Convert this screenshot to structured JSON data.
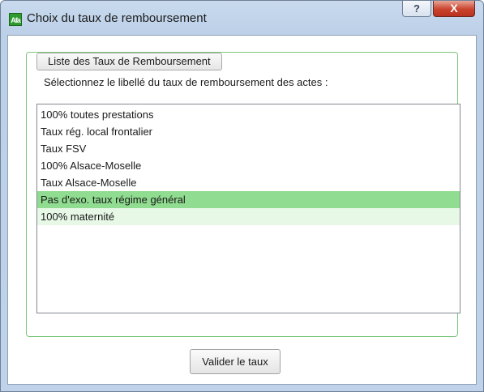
{
  "window": {
    "title": "Choix du taux de remboursement",
    "app_icon_text": "Afa",
    "help_label": "?",
    "close_label": "X"
  },
  "group": {
    "legend": "Liste des Taux de Remboursement",
    "instruction": "Sélectionnez le libellé du taux de remboursement des actes :"
  },
  "list": {
    "items": [
      {
        "label": "100% toutes prestations",
        "state": "normal"
      },
      {
        "label": "Taux rég. local frontalier",
        "state": "normal"
      },
      {
        "label": "Taux FSV",
        "state": "normal"
      },
      {
        "label": "100% Alsace-Moselle",
        "state": "normal"
      },
      {
        "label": "Taux Alsace-Moselle",
        "state": "normal"
      },
      {
        "label": "Pas d'exo. taux régime général",
        "state": "selected"
      },
      {
        "label": "100% maternité",
        "state": "hover"
      }
    ]
  },
  "buttons": {
    "validate_label": "Valider le taux"
  },
  "colors": {
    "selected_row": "#90dc90",
    "hover_row": "#e7f8e7",
    "group_border": "#7cc77c",
    "title_bar": "#bfd2e9"
  }
}
